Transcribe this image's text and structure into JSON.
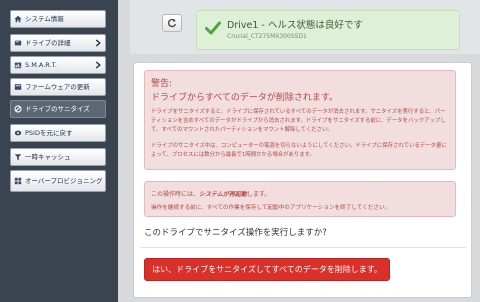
{
  "sidebar": {
    "items": [
      {
        "label": "システム情報",
        "icon": "home-icon"
      },
      {
        "label": "ドライブの詳細",
        "icon": "drive-icon"
      },
      {
        "label": "S.M.A.R.T.",
        "icon": "chart-icon"
      },
      {
        "label": "ファームウェアの更新",
        "icon": "firmware-icon"
      },
      {
        "label": "ドライブのサニタイズ",
        "icon": "sanitize-icon"
      },
      {
        "label": "PSIDを元に戻す",
        "icon": "psid-icon"
      },
      {
        "label": "一時キャッシュ",
        "icon": "filter-icon"
      },
      {
        "label": "オーバープロビジョニング",
        "icon": "grid-icon"
      }
    ],
    "active_index": 4
  },
  "header": {
    "refresh_icon": "refresh-icon",
    "health_title": "Drive1 - ヘルス状態は良好です",
    "health_model": "Crucial_CT275MX300SSD1",
    "health_icon": "checkmark-icon"
  },
  "warning": {
    "heading1": "警告:",
    "heading2": "ドライブからすべてのデータが削除されます。",
    "body1": "ドライブをサニタイズすると、ドライブに保存されているすべてのデータが消去されます。サニタイズを実行すると、パーティションを含めすべてのデータがドライブから消去されます。ドライブをサニタイズする前に、データをバックアップして、すべてのマウントされたパーティションをマウント解除してください。",
    "body2": "ドライブのサニタイズ中は、コンピューターの電源を切らないようにしてください。ドライブに保存されているデータ量によって、プロセスには数分から最長で1時間かかる場合があります。"
  },
  "info": {
    "line1_prefix": "この操作時には、",
    "line1_bold": "システムが再起動",
    "line1_suffix": "します。",
    "line2": "操作を継続する前に、すべての作業を保存して起動中のアプリケーションを終了してください。"
  },
  "confirm": {
    "question": "このドライブでサニタイズ操作を実行しますか?",
    "button_label": "はい、ドライブをサニタイズしてすべてのデータを削除します。"
  },
  "colors": {
    "sidebar_bg": "#3a4350",
    "success_bg": "#dff0d8",
    "danger_bg": "#f2dede",
    "danger_text": "#b34a48",
    "danger_button": "#d9302a"
  }
}
